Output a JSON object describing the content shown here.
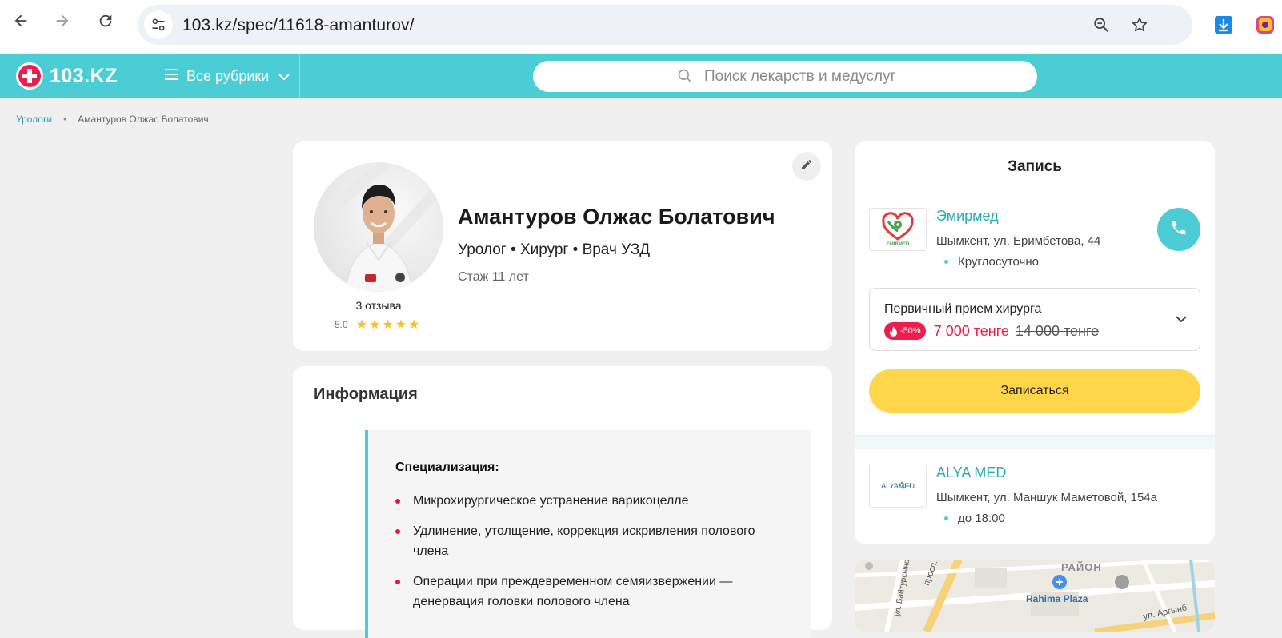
{
  "browser": {
    "url": "103.kz/spec/11618-amanturov/"
  },
  "header": {
    "logo_text": "103.KZ",
    "rubrics_label": "Все рубрики",
    "search_placeholder": "Поиск лекарств и медуслуг"
  },
  "breadcrumb": {
    "parent": "Урологи",
    "current": "Амантуров Олжас Болатович"
  },
  "doctor": {
    "name": "Амантуров Олжас Болатович",
    "specialties": "Уролог • Хирург • Врач УЗД",
    "experience": "Стаж 11 лет",
    "reviews": "3 отзыва",
    "rating": "5.0",
    "stars": 5
  },
  "info": {
    "title": "Информация",
    "spec_title": "Специализация:",
    "items": [
      "Микрохирургическое устранение варикоцелле",
      "Удлинение, утолщение, коррекция искривления полового члена",
      "Операции при преждевременном семяизвержении — денервация головки полового члена"
    ]
  },
  "booking": {
    "title": "Запись",
    "clinics": [
      {
        "name": "Эмирмед",
        "logo_text": "EMIRMED",
        "address": "Шымкент, ул. Еримбетова, 44",
        "hours": "Круглосуточно"
      },
      {
        "name": "ALYA MED",
        "logo_text": "ALYAMED",
        "address": "Шымкент, ул. Маншук Маметовой, 154а",
        "hours": "до 18:00"
      }
    ],
    "service": {
      "name": "Первичный прием хирурга",
      "discount": "-50%",
      "price_new": "7 000 тенге",
      "price_old": "14 000 тенге"
    },
    "book_label": "Записаться"
  },
  "map": {
    "labels": [
      "РАЙОН",
      "Rahima Plaza",
      "просп. Б",
      "ул. Байтурсыно",
      "ул. Аргынб"
    ]
  },
  "colors": {
    "brand": "#4ccdd6",
    "accent_red": "#ef1d4e",
    "book_button": "#ffd54a",
    "star": "#f6c12d"
  }
}
